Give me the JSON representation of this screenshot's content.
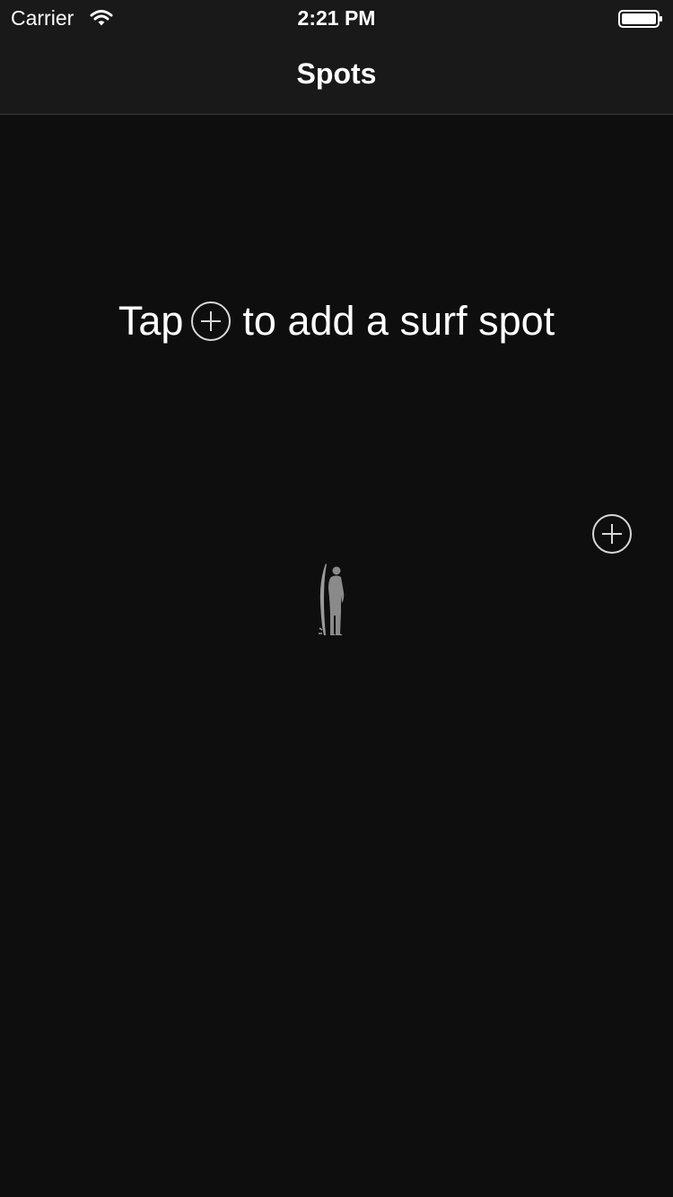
{
  "status_bar": {
    "carrier": "Carrier",
    "time": "2:21 PM",
    "wifi_icon": "wifi-icon",
    "battery_icon": "battery-full-icon"
  },
  "nav": {
    "title": "Spots"
  },
  "empty_state": {
    "hint_before": "Tap",
    "hint_icon": "plus-circle-icon",
    "hint_after": "to add a surf spot",
    "illustration": "surfer-icon"
  },
  "actions": {
    "add_button_icon": "plus-circle-icon"
  },
  "colors": {
    "background": "#0e0e0e",
    "nav_background": "#191919",
    "text": "#ffffff",
    "icon_stroke": "#d8d8d8",
    "illustration": "#8a8a8a"
  }
}
